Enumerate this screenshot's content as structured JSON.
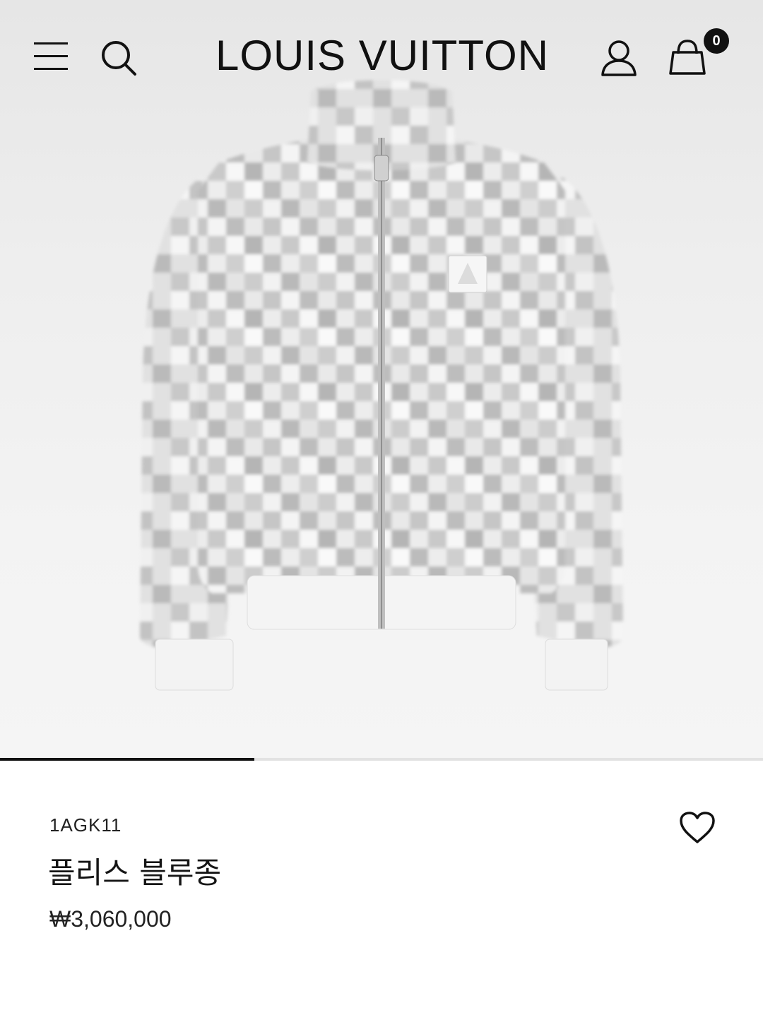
{
  "header": {
    "brand": "LOUIS VUITTON",
    "cart_count": "0",
    "icons": [
      "menu-icon",
      "search-icon",
      "account-icon",
      "shopping-bag-icon"
    ]
  },
  "gallery": {
    "progress": 0.333
  },
  "product": {
    "sku": "1AGK11",
    "name": "플리스 블루종",
    "price": "₩3,060,000"
  },
  "colors": {
    "ink": "#111111",
    "background": "#ffffff",
    "image_background": "#eeeeee"
  }
}
